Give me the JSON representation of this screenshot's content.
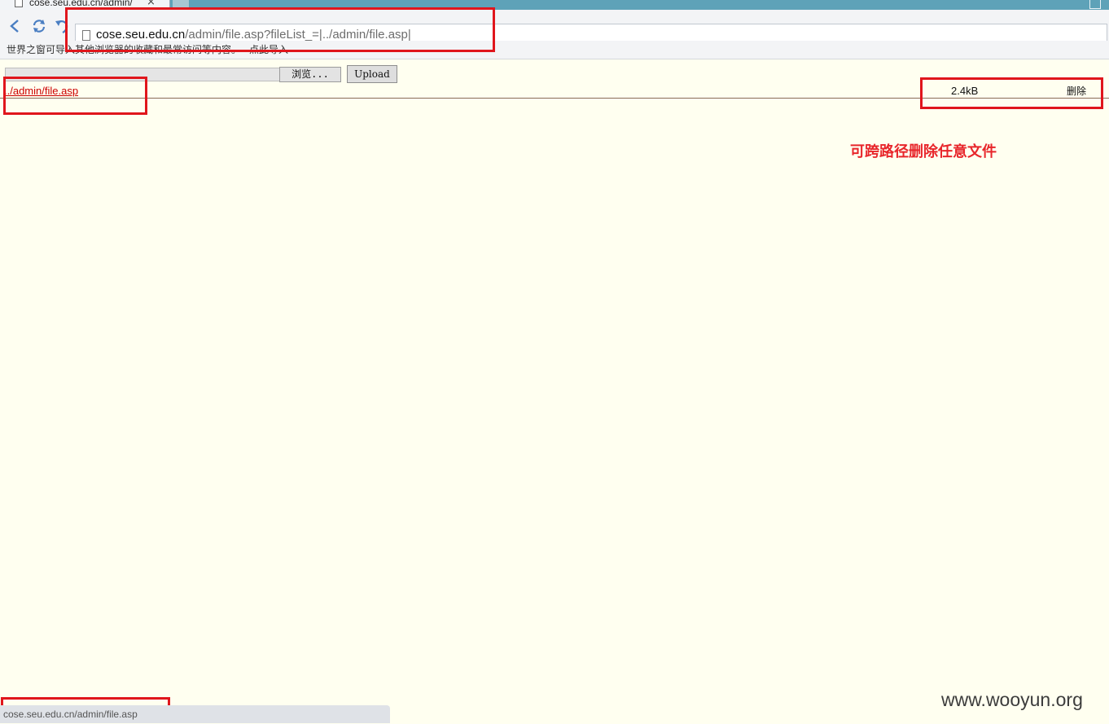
{
  "browser": {
    "tab_title": "cose.seu.edu.cn/admin/",
    "tab_close": "×",
    "url_host": "cose.seu.edu.cn",
    "url_path": "/admin/file.asp?fileList_=|../admin/file.asp|",
    "bookmark_message": "世界之窗可导入其他浏览器的收藏和最常访问等内容。",
    "bookmark_import_link": "点此导入",
    "status_text": "cose.seu.edu.cn/admin/file.asp"
  },
  "icons": {
    "back": "back-arrow-icon",
    "refresh": "refresh-icon",
    "undo": "undo-icon",
    "page": "page-icon"
  },
  "upload_form": {
    "browse_label": "浏览...",
    "upload_label": "Upload"
  },
  "file_list": [
    {
      "name": "../admin/file.asp",
      "size": "2.4kB",
      "action": "删除"
    }
  ],
  "annotation": {
    "note": "可跨路径删除任意文件",
    "box_color": "#e0161c"
  },
  "watermark": "www.wooyun.org"
}
